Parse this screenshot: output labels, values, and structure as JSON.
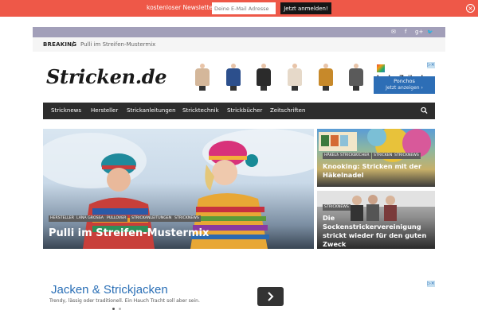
{
  "newsletter": {
    "label": "kostenloser Newsletter",
    "email_placeholder": "Deine E-Mail Adresse",
    "submit_label": "Jetzt anmelden!",
    "close_icon": "close-icon"
  },
  "social": {
    "icons": [
      "mail-icon",
      "facebook-icon",
      "google-plus-icon",
      "twitter-icon"
    ],
    "glyphs": [
      "✉",
      "f",
      "g+",
      "🐦"
    ]
  },
  "breaking": {
    "label": "BREAKING",
    "separator": "/",
    "headline": "Pulli im Streifen-Mustermix"
  },
  "logo": {
    "text": "Stricken.de"
  },
  "header_ad": {
    "brand": "LadenZeile.de",
    "product": "Ponchos",
    "cta": "Jetzt anzeigen ›",
    "ad_badge": "▷×",
    "figure_colors": [
      "#d4b79a",
      "#2c4f8c",
      "#2b2b2b",
      "#e6d9c9",
      "#c7892a",
      "#5a5a5a"
    ]
  },
  "nav": {
    "items": [
      "Stricknews",
      "Hersteller",
      "Strickanleitungen",
      "Stricktechnik",
      "Strickbücher",
      "Zeitschriften"
    ],
    "search_icon": "search-icon"
  },
  "feature": {
    "tags": [
      "HERSTELLER",
      "LANA GROSSA",
      "PULLOVER",
      "STRICKANLEITUNGEN",
      "STRICKNEWS"
    ],
    "title": "Pulli im Streifen-Mustermix"
  },
  "side_posts": [
    {
      "tags": [
        "HÄKELN",
        "STRICKBÜCHER",
        "STRICKEN",
        "STRICKNEWS"
      ],
      "title_lines": [
        "Knooking: Stricken mit der",
        "Häkelnadel"
      ]
    },
    {
      "tags": [
        "STRICKNEWS"
      ],
      "title_lines": [
        "Die Sockenstrickervereinigung",
        "strickt wieder für den guten",
        "Zweck"
      ]
    }
  ],
  "bottom_ad": {
    "title": "Jacken & Strickjacken",
    "subtitle": "Trendy, lässig oder traditionell. Ein Hauch Tracht soll aber sein.",
    "ad_badge": "▷×",
    "next_icon": "chevron-right-icon"
  },
  "colors": {
    "newsletter_bar": "#ee5848",
    "social_bar": "#a29fb9",
    "nav_bg": "#2d2d2d",
    "tag_green": "#5b9a3e",
    "ad_blue": "#2d6eb6"
  }
}
